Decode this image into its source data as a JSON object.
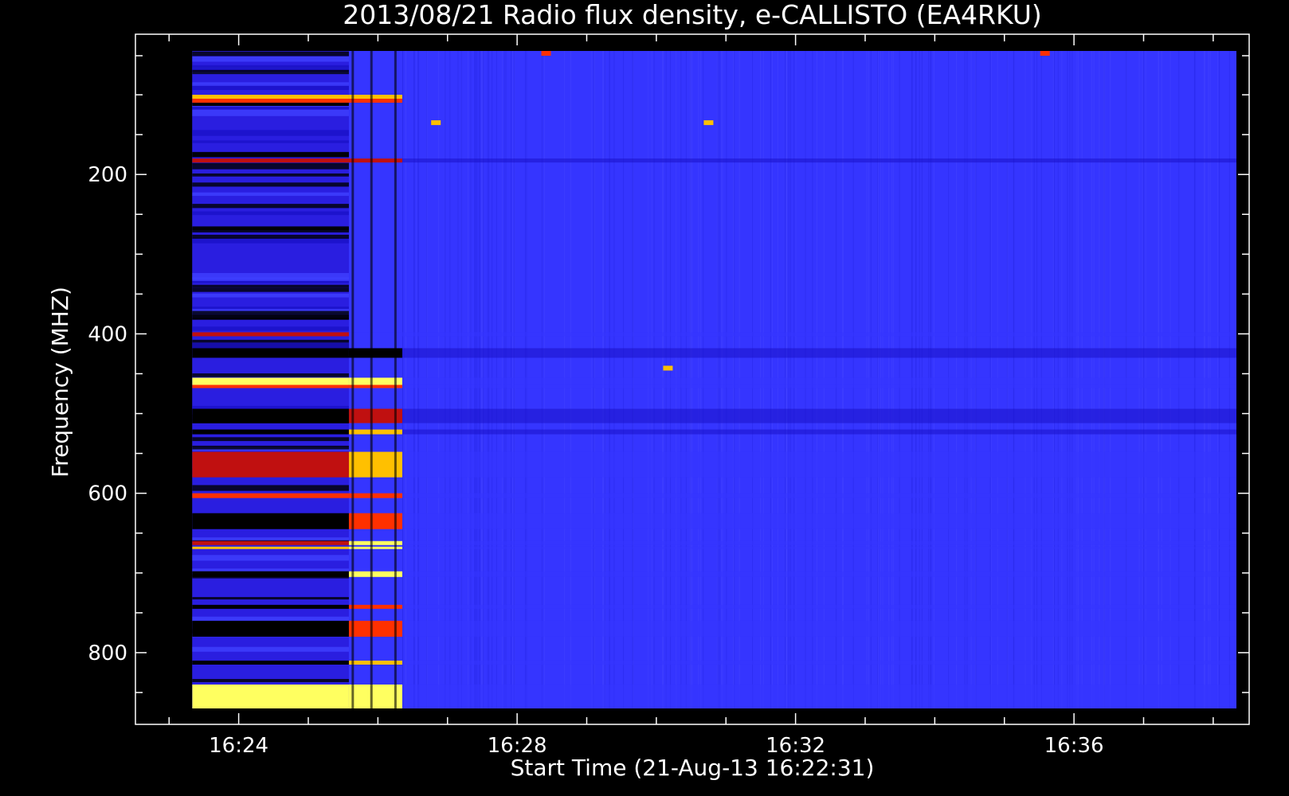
{
  "chart_data": {
    "type": "heatmap",
    "title": "2013/08/21  Radio flux density, e-CALLISTO (EA4RKU)",
    "xlabel": "Start Time (21-Aug-13 16:22:31)",
    "ylabel": "Frequency (MHZ)",
    "x_unit": "time (HH:MM, UT)",
    "y_unit": "MHz",
    "xlim": [
      "16:22:31",
      "16:38:31"
    ],
    "data_xlim": [
      "16:23:20",
      "16:38:20"
    ],
    "ylim": [
      45,
      870
    ],
    "data_ylim": [
      45,
      870
    ],
    "y_inverted": true,
    "x_ticks": [
      "16:24",
      "16:28",
      "16:32",
      "16:36"
    ],
    "y_ticks": [
      200,
      400,
      600,
      800
    ],
    "colormap": [
      "#000000",
      "#1a10c8",
      "#3535ff",
      "#c01010",
      "#ff3000",
      "#ffc000",
      "#ffff60"
    ],
    "background_color": "#3535ff",
    "burst": {
      "description_note": "",
      "start": "16:25:35",
      "end": "16:26:21"
    },
    "pre_burst_end": "16:25:35",
    "frequency_bands": [
      {
        "freq_min": 100,
        "freq_max": 105,
        "intensity_pre": 5,
        "intensity_burst": 5,
        "intensity_post": 0
      },
      {
        "freq_min": 105,
        "freq_max": 110,
        "intensity_pre": 4,
        "intensity_burst": 4,
        "intensity_post": 0
      },
      {
        "freq_min": 110,
        "freq_max": 114,
        "intensity_pre": 0,
        "intensity_burst": 2,
        "intensity_post": 0
      },
      {
        "freq_min": 180,
        "freq_max": 185,
        "intensity_pre": 3,
        "intensity_burst": 3,
        "intensity_post": 1
      },
      {
        "freq_min": 398,
        "freq_max": 403,
        "intensity_pre": 3,
        "intensity_burst": 2,
        "intensity_post": 2
      },
      {
        "freq_min": 418,
        "freq_max": 430,
        "intensity_pre": 0,
        "intensity_burst": 0,
        "intensity_post": 1
      },
      {
        "freq_min": 455,
        "freq_max": 464,
        "intensity_pre": 6,
        "intensity_burst": 6,
        "intensity_post": 2
      },
      {
        "freq_min": 464,
        "freq_max": 468,
        "intensity_pre": 4,
        "intensity_burst": 4,
        "intensity_post": 2
      },
      {
        "freq_min": 494,
        "freq_max": 512,
        "intensity_pre": 0,
        "intensity_burst": 3,
        "intensity_post": 1
      },
      {
        "freq_min": 520,
        "freq_max": 526,
        "intensity_pre": 0,
        "intensity_burst": 5,
        "intensity_post": 1
      },
      {
        "freq_min": 548,
        "freq_max": 580,
        "intensity_pre": 3,
        "intensity_burst": 5,
        "intensity_post": 2
      },
      {
        "freq_min": 600,
        "freq_max": 606,
        "intensity_pre": 4,
        "intensity_burst": 4,
        "intensity_post": 2
      },
      {
        "freq_min": 625,
        "freq_max": 645,
        "intensity_pre": 0,
        "intensity_burst": 4,
        "intensity_post": 2
      },
      {
        "freq_min": 660,
        "freq_max": 665,
        "intensity_pre": 3,
        "intensity_burst": 6,
        "intensity_post": 2
      },
      {
        "freq_min": 667,
        "freq_max": 670,
        "intensity_pre": 5,
        "intensity_burst": 6,
        "intensity_post": 2
      },
      {
        "freq_min": 698,
        "freq_max": 705,
        "intensity_pre": 0,
        "intensity_burst": 6,
        "intensity_post": 2
      },
      {
        "freq_min": 740,
        "freq_max": 745,
        "intensity_pre": 0,
        "intensity_burst": 4,
        "intensity_post": 2
      },
      {
        "freq_min": 760,
        "freq_max": 780,
        "intensity_pre": 0,
        "intensity_burst": 4,
        "intensity_post": 2
      },
      {
        "freq_min": 810,
        "freq_max": 815,
        "intensity_pre": 0,
        "intensity_burst": 5,
        "intensity_post": 2
      },
      {
        "freq_min": 840,
        "freq_max": 870,
        "intensity_pre": 6,
        "intensity_burst": 6,
        "intensity_post": 2
      }
    ],
    "hot_spots": [
      {
        "time": "16:30:10",
        "freq": 443,
        "intensity": 5
      },
      {
        "time": "16:28:25",
        "freq": 48,
        "intensity": 4
      },
      {
        "time": "16:35:35",
        "freq": 48,
        "intensity": 4
      },
      {
        "time": "16:30:45",
        "freq": 135,
        "intensity": 5
      },
      {
        "time": "16:26:50",
        "freq": 135,
        "intensity": 5
      }
    ],
    "grid": false,
    "legend": "none"
  }
}
